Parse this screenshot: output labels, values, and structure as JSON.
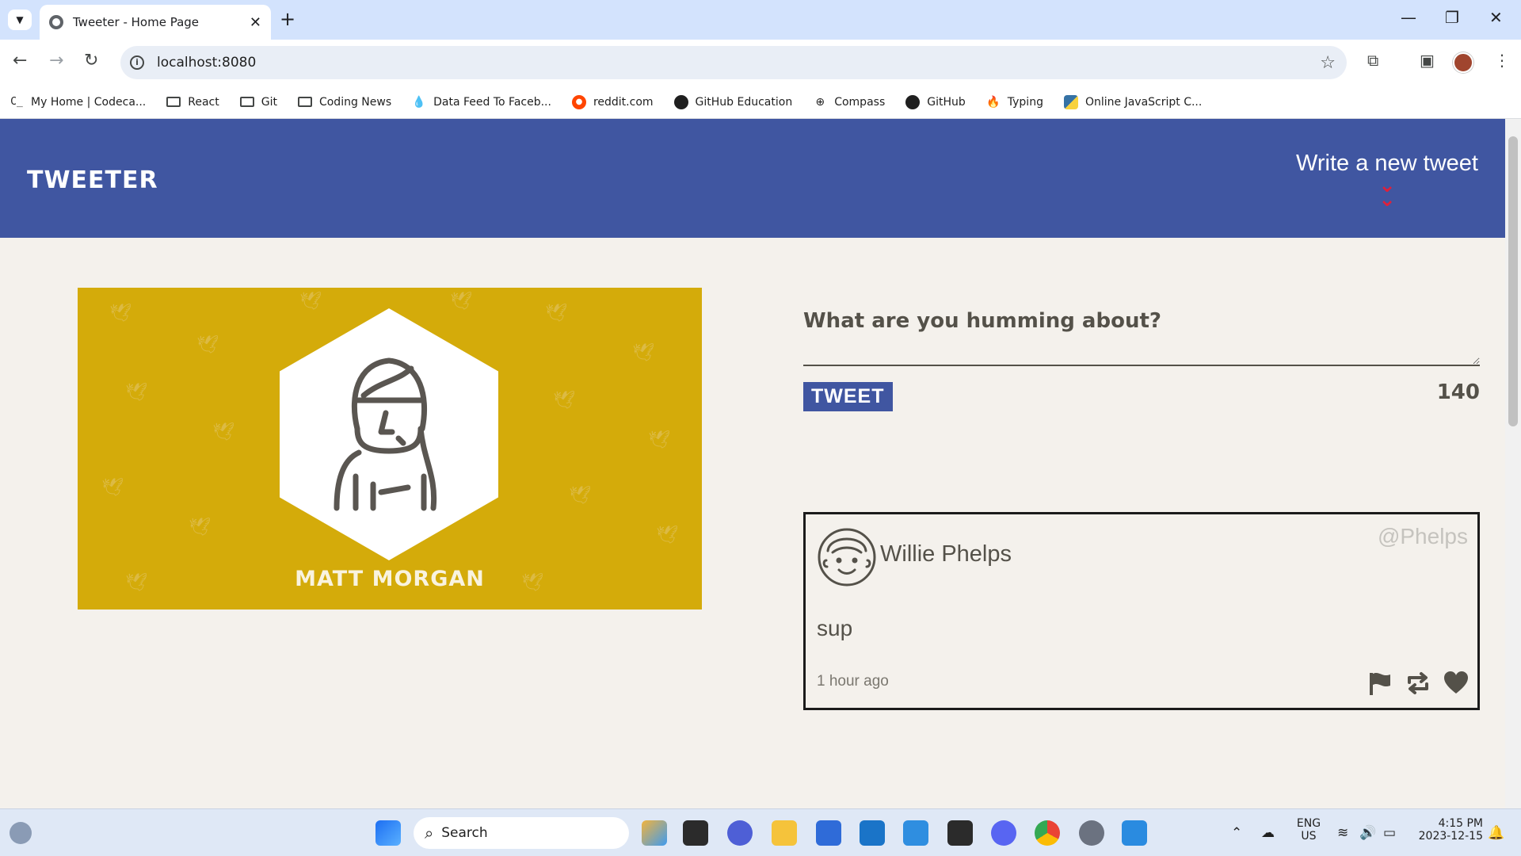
{
  "browser": {
    "tab_title": "Tweeter - Home Page",
    "url": "localhost:8080",
    "bookmarks": [
      {
        "label": "My Home | Codeca...",
        "icon": "codecademy-icon"
      },
      {
        "label": "React",
        "icon": "folder-icon"
      },
      {
        "label": "Git",
        "icon": "folder-icon"
      },
      {
        "label": "Coding News",
        "icon": "folder-icon"
      },
      {
        "label": "Data Feed To Faceb...",
        "icon": "droplet-icon"
      },
      {
        "label": "reddit.com",
        "icon": "reddit-icon"
      },
      {
        "label": "GitHub Education",
        "icon": "github-icon"
      },
      {
        "label": "Compass",
        "icon": "compass-icon"
      },
      {
        "label": "GitHub",
        "icon": "github-icon"
      },
      {
        "label": "Typing",
        "icon": "typing-icon"
      },
      {
        "label": "Online JavaScript C...",
        "icon": "python-icon"
      }
    ]
  },
  "header": {
    "brand": "TWEETER",
    "compose_toggle": "Write a new tweet",
    "chevron_icon": "double-chevron-down-icon"
  },
  "profile": {
    "name": "MATT MORGAN"
  },
  "composer": {
    "prompt": "What are you humming about?",
    "button": "TWEET",
    "counter": "140"
  },
  "tweet": {
    "name": "Willie Phelps",
    "handle": "@Phelps",
    "body": "sup",
    "time": "1 hour ago",
    "actions": [
      "flag-icon",
      "retweet-icon",
      "heart-icon"
    ]
  },
  "taskbar": {
    "search_label": "Search",
    "lang_line1": "ENG",
    "lang_line2": "US",
    "clock_time": "4:15 PM",
    "clock_date": "2023-12-15"
  },
  "colors": {
    "header_bg": "#4056a1",
    "accent_red": "#e0203a",
    "profile_bg": "#d4ab0a",
    "page_bg": "#f4f1ec"
  }
}
